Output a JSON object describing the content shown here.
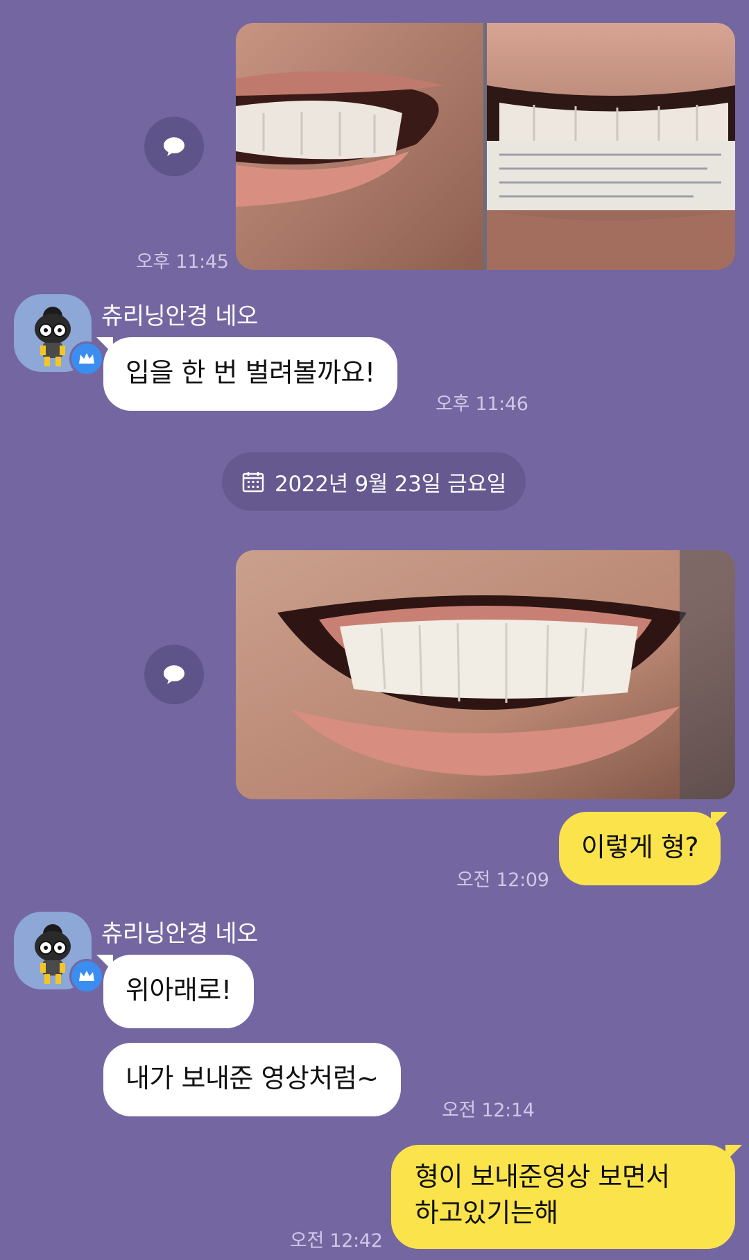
{
  "colors": {
    "background": "#7467a1",
    "incoming_bubble": "#ffffff",
    "outgoing_bubble": "#fbe44b",
    "timestamp": "#cfc8e6",
    "avatar_bg": "#8da7d6",
    "badge": "#3b8df0"
  },
  "messages": {
    "photo1": {
      "time": "오후 11:45",
      "share_icon": "speech-bubble-icon"
    },
    "incoming1": {
      "sender": "츄리닝안경 네오",
      "text": "입을 한 번 벌려볼까요!",
      "time": "오후 11:46"
    },
    "date_divider": {
      "icon": "calendar-icon",
      "text": "2022년 9월 23일 금요일"
    },
    "photo2": {
      "share_icon": "speech-bubble-icon"
    },
    "outgoing1": {
      "text": "이렇게 형?",
      "time": "오전 12:09"
    },
    "incoming2": {
      "sender": "츄리닝안경 네오",
      "text1": "위아래로!",
      "text2": "내가 보내준 영상처럼~",
      "time": "오전 12:14"
    },
    "outgoing2": {
      "line1": "형이 보내준영상 보면서",
      "line2": "하고있기는해",
      "time": "오전 12:42"
    }
  }
}
